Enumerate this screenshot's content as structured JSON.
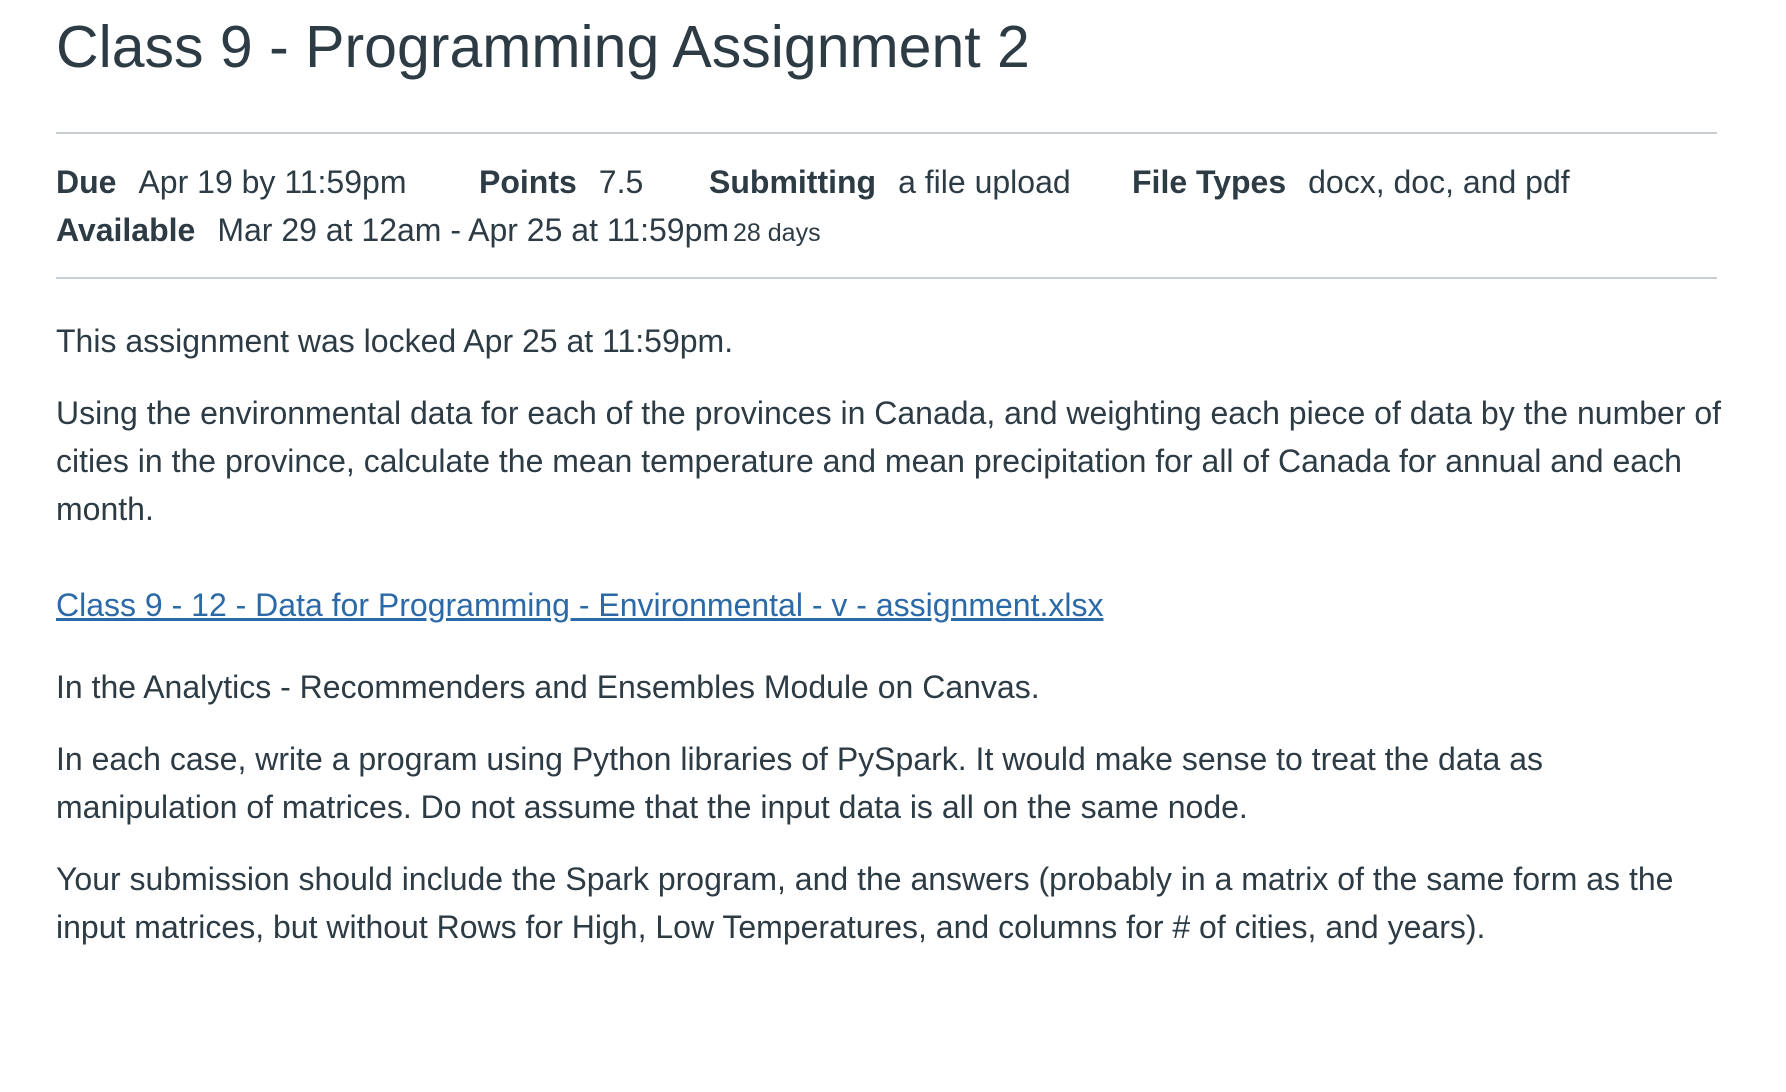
{
  "assignment": {
    "title": "Class 9 - Programming Assignment 2"
  },
  "details": {
    "due_label": "Due",
    "due_value": "Apr 19 by 11:59pm",
    "points_label": "Points",
    "points_value": "7.5",
    "submitting_label": "Submitting",
    "submitting_value": "a file upload",
    "file_types_label": "File Types",
    "file_types_value": "docx, doc, and pdf",
    "available_label": "Available",
    "available_value": "Mar 29 at 12am - Apr 25 at 11:59pm",
    "available_days": "28 days"
  },
  "content": {
    "lock_notice": "This assignment was locked Apr 25 at 11:59pm.",
    "intro": "Using the environmental data for each of the provinces in Canada, and weighting each piece of data by the number of cities in the province, calculate the mean temperature and mean precipitation for all of Canada for annual and each month.",
    "file_link": "Class 9 - 12 - Data for Programming - Environmental - v - assignment.xlsx",
    "module_note": "In the Analytics - Recommenders and Ensembles Module on Canvas.",
    "instructions": "In each case, write a program using Python libraries of PySpark.  It would make sense to treat the data as manipulation of matrices.  Do not assume that the input data is all on the same node.",
    "submission_note": "Your submission should include the Spark program, and the answers (probably in a matrix of the same form as the input matrices, but without Rows for High, Low Temperatures, and columns for # of cities, and years)."
  },
  "colors": {
    "text": "#2d3b45",
    "link": "#2b6aa7",
    "rule": "#c7cdd1"
  }
}
